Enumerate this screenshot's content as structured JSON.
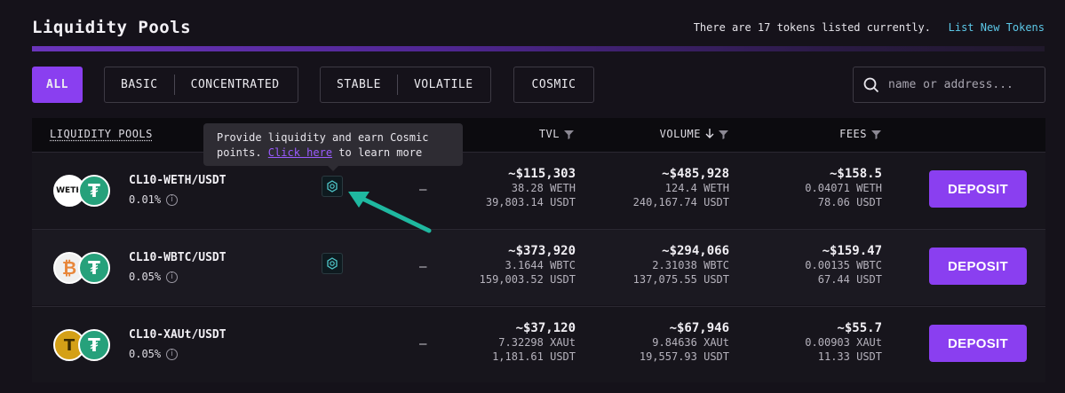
{
  "header": {
    "title": "Liquidity Pools",
    "listed_text": "There are 17 tokens listed currently.",
    "list_new_label": "List New Tokens"
  },
  "filters": {
    "all": "ALL",
    "basic": "BASIC",
    "concentrated": "CONCENTRATED",
    "stable": "STABLE",
    "volatile": "VOLATILE",
    "cosmic": "COSMIC",
    "search_placeholder": "name or address..."
  },
  "table": {
    "headers": {
      "pools": "LIQUIDITY POOLS",
      "tvl": "TVL",
      "volume": "VOLUME",
      "fees": "FEES"
    },
    "deposit_label": "DEPOSIT",
    "rows": [
      {
        "name": "CL10-WETH/USDT",
        "fee": "0.01%",
        "token_a": "WETH",
        "dash": "—",
        "tvl": {
          "main": "~$115,303",
          "a": "38.28 WETH",
          "b": "39,803.14 USDT"
        },
        "volume": {
          "main": "~$485,928",
          "a": "124.4 WETH",
          "b": "240,167.74 USDT"
        },
        "fees": {
          "main": "~$158.5",
          "a": "0.04071 WETH",
          "b": "78.06 USDT"
        }
      },
      {
        "name": "CL10-WBTC/USDT",
        "fee": "0.05%",
        "token_a": "WBTC",
        "dash": "—",
        "tvl": {
          "main": "~$373,920",
          "a": "3.1644 WBTC",
          "b": "159,003.52 USDT"
        },
        "volume": {
          "main": "~$294,066",
          "a": "2.31038 WBTC",
          "b": "137,075.55 USDT"
        },
        "fees": {
          "main": "~$159.47",
          "a": "0.00135 WBTC",
          "b": "67.44 USDT"
        }
      },
      {
        "name": "CL10-XAUt/USDT",
        "fee": "0.05%",
        "token_a": "XAUt",
        "dash": "—",
        "tvl": {
          "main": "~$37,120",
          "a": "7.32298 XAUt",
          "b": "1,181.61 USDT"
        },
        "volume": {
          "main": "~$67,946",
          "a": "9.84636 XAUt",
          "b": "19,557.93 USDT"
        },
        "fees": {
          "main": "~$55.7",
          "a": "0.00903 XAUt",
          "b": "11.33 USDT"
        }
      }
    ]
  },
  "tooltip": {
    "line1": "Provide liquidity and earn Cosmic",
    "line2_pre": "points. ",
    "link": "Click here",
    "line2_post": " to learn more"
  },
  "colors": {
    "accent": "#8a3ff0",
    "link": "#5cc8e8",
    "tether": "#26a17b",
    "arrow": "#1fb8a0"
  }
}
